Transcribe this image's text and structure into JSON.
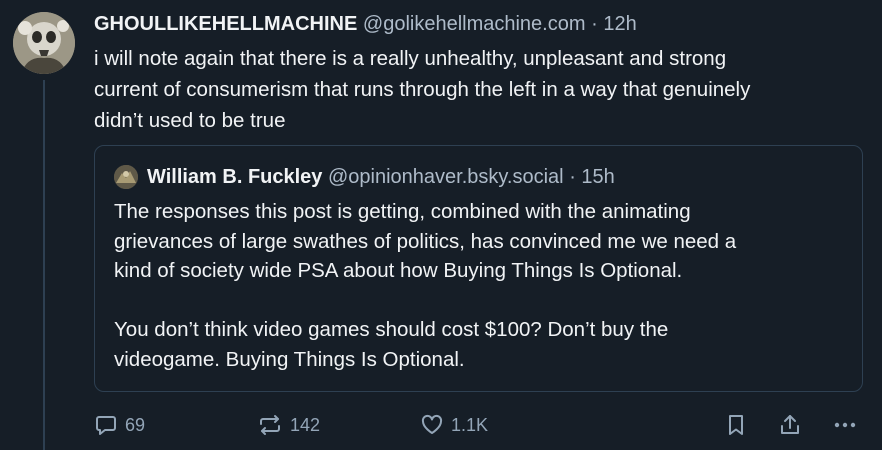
{
  "post": {
    "author_name": "GHOULLIKEHELLMACHINE",
    "author_handle": "@golikehellmachine.com",
    "separator": "·",
    "time": "12h",
    "text": "i will note again that there is a really unhealthy, unpleasant and strong\ncurrent of consumerism that runs through the left in a way that genuinely\ndidn’t used to be true"
  },
  "quote": {
    "author_name": "William B. Fuckley",
    "author_handle": "@opinionhaver.bsky.social",
    "separator": "·",
    "time": "15h",
    "text": "The responses this post is getting, combined with the animating\ngrievances of large swathes of politics, has convinced me we need a\nkind of society wide PSA about how Buying Things Is Optional.\n\nYou don’t think video games should cost $100? Don’t buy the\nvideogame. Buying Things Is Optional."
  },
  "actions": {
    "reply_count": "69",
    "repost_count": "142",
    "like_count": "1.1K",
    "icons": [
      "reply-icon",
      "repost-icon",
      "like-icon",
      "bookmark-icon",
      "share-icon",
      "more-icon"
    ]
  },
  "colors": {
    "background": "#161e27",
    "text": "#f1f3f5",
    "muted": "#aebbc9",
    "icon": "#93a5b7",
    "border": "#2e4052"
  }
}
